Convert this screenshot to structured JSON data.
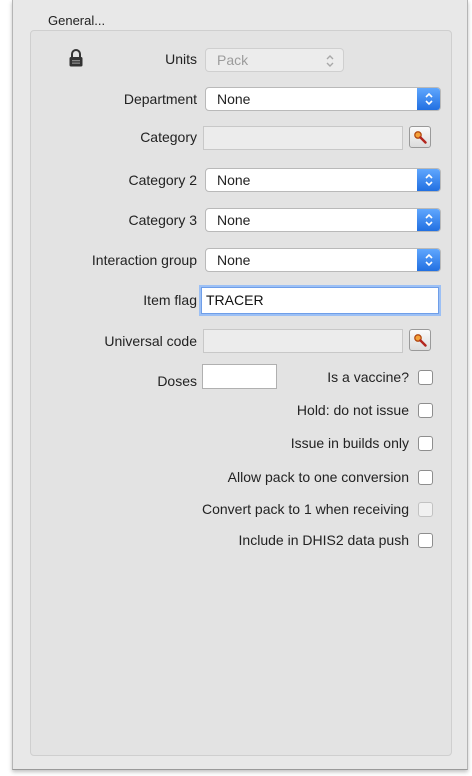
{
  "group_title": "General...",
  "units": {
    "label": "Units",
    "value": "Pack"
  },
  "department": {
    "label": "Department",
    "value": "None"
  },
  "category": {
    "label": "Category",
    "value": ""
  },
  "category2": {
    "label": "Category 2",
    "value": "None"
  },
  "category3": {
    "label": "Category 3",
    "value": "None"
  },
  "interaction_group": {
    "label": "Interaction group",
    "value": "None"
  },
  "item_flag": {
    "label": "Item flag",
    "value": "TRACER"
  },
  "universal_code": {
    "label": "Universal code",
    "value": ""
  },
  "doses": {
    "label": "Doses",
    "value": ""
  },
  "checkboxes": {
    "is_vaccine": {
      "label": "Is a vaccine?",
      "checked": false
    },
    "hold": {
      "label": "Hold: do not issue",
      "checked": false
    },
    "builds_only": {
      "label": "Issue in builds only",
      "checked": false
    },
    "pack_to_one": {
      "label": "Allow pack to one conversion",
      "checked": false
    },
    "convert_receiving": {
      "label": "Convert pack to 1 when receiving",
      "checked": false,
      "disabled": true
    },
    "dhis2": {
      "label": "Include in DHIS2 data push",
      "checked": false
    }
  },
  "colors": {
    "accent": "#2f7ff0",
    "focus": "#9cc0f5"
  }
}
